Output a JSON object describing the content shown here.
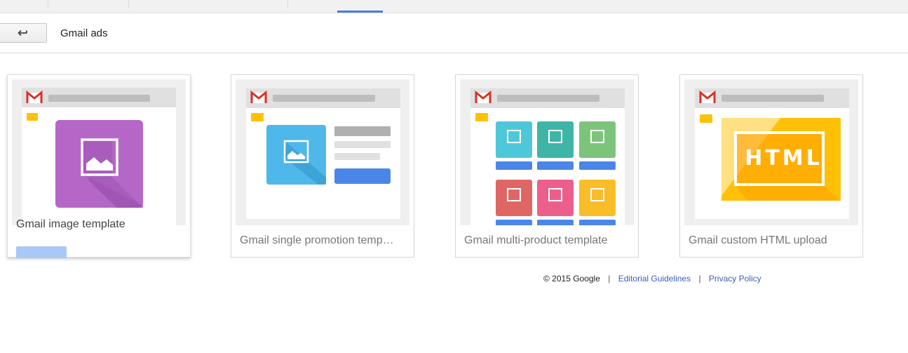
{
  "header": {
    "title": "Gmail ads"
  },
  "templates": [
    {
      "label": "Gmail image template"
    },
    {
      "label": "Gmail single promotion temp…"
    },
    {
      "label": "Gmail multi-product template"
    },
    {
      "label": "Gmail custom HTML upload"
    }
  ],
  "html_thumb_text": "HTML",
  "footer": {
    "copyright": "© 2015 Google",
    "sep1": "|",
    "editorial": "Editorial Guidelines",
    "sep2": "|",
    "privacy": "Privacy Policy"
  },
  "colors": {
    "accent": "#4a7fd6",
    "gmail_red": "#d93025",
    "purple": "#b567c8",
    "blue_image": "#4fb8ea",
    "button_blue": "#4a86e8",
    "yellow": "#ffb300"
  },
  "icons": {
    "back": "back-arrow-icon",
    "gmail": "gmail-logo-icon",
    "image": "image-placeholder-icon"
  }
}
